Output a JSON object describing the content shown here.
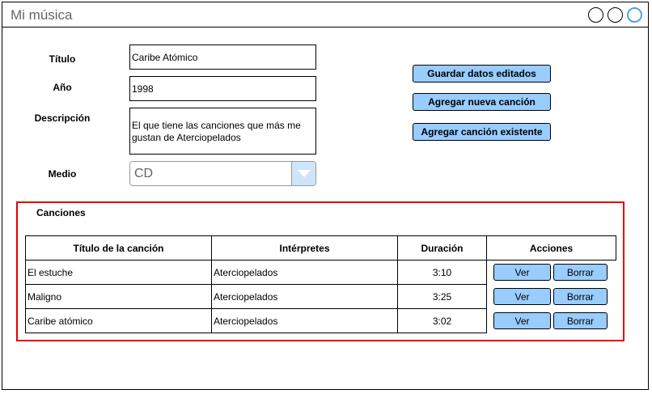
{
  "window": {
    "title": "Mi música"
  },
  "form": {
    "titulo_label": "Título",
    "titulo_value": "Caribe Atómico",
    "anio_label": "Año",
    "anio_value": "1998",
    "descripcion_label": "Descripción",
    "descripcion_value": "El que tiene las canciones que más me gustan de Aterciopelados",
    "medio_label": "Medio",
    "medio_value": "CD"
  },
  "actions": {
    "guardar": "Guardar datos editados",
    "agregar_nueva": "Agregar nueva canción",
    "agregar_existente": "Agregar canción existente"
  },
  "canciones": {
    "title": "Canciones",
    "headers": [
      "Título de la canción",
      "Intérpretes",
      "Duración",
      "Acciones"
    ],
    "rows": [
      {
        "titulo": "El estuche",
        "interpretes": "Aterciopelados",
        "duracion": "3:10",
        "ver": "Ver",
        "borrar": "Borrar"
      },
      {
        "titulo": "Maligno",
        "interpretes": "Aterciopelados",
        "duracion": "3:25",
        "ver": "Ver",
        "borrar": "Borrar"
      },
      {
        "titulo": "Caribe atómico",
        "interpretes": "Aterciopelados",
        "duracion": "3:02",
        "ver": "Ver",
        "borrar": "Borrar"
      }
    ]
  },
  "colors": {
    "button": "#99ccff",
    "highlight": "#e60000",
    "accent": "#4fa3d9"
  }
}
